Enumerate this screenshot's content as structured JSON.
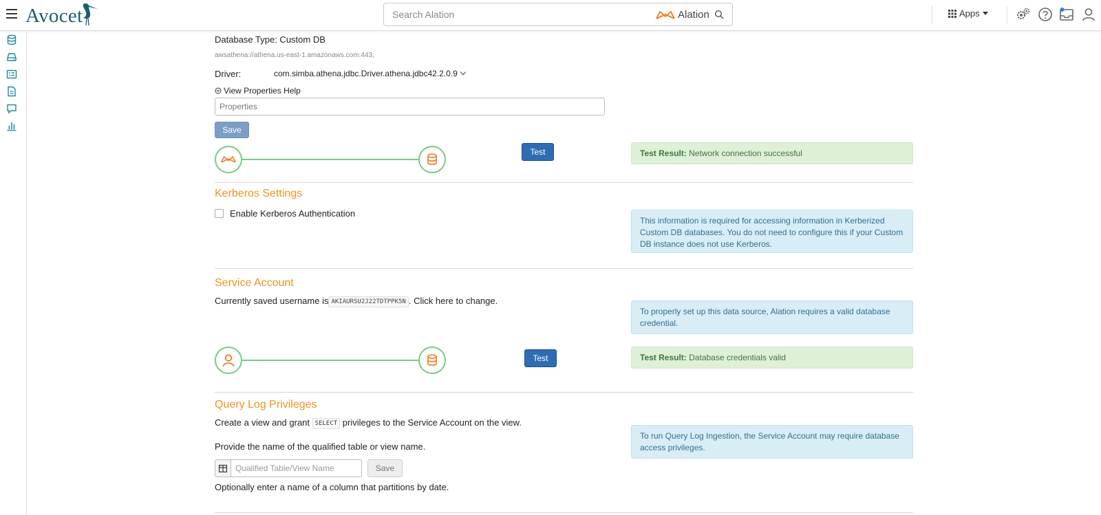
{
  "header": {
    "logo_text": "Avocet",
    "search_placeholder": "Search Alation",
    "search_brand": "Alation",
    "apps_label": "Apps"
  },
  "icons": {
    "menu": "hamburger-icon",
    "search": "search-icon",
    "apps": "grid-icon",
    "settings": "gears-icon",
    "help": "help-icon",
    "inbox": "inbox-icon",
    "user": "user-icon",
    "rail": [
      "database-icon",
      "storage-icon",
      "catalog-icon",
      "document-icon",
      "conversation-icon",
      "bar-chart-icon"
    ]
  },
  "colors": {
    "brand": "#1c5e73",
    "section_title": "#f0931f",
    "success_bg": "#dff0d8",
    "info_bg": "#d9edf7",
    "primary_button": "#2e6db3",
    "connector": "#7ac982",
    "node_icon": "#f07a22"
  },
  "connection": {
    "database_type": "Database Type: Custom DB",
    "jdbc_uri": "awsathena://athena.us-east-1.amazonaws.com:443;",
    "driver_label": "Driver:",
    "driver_value": "com.simba.athena.jdbc.Driver.athena.jdbc42.2.0.9",
    "view_properties_help": "View Properties Help",
    "properties_placeholder": "Properties",
    "save_label": "Save",
    "test_label": "Test",
    "test_result_label": "Test Result:",
    "test_result_text": "Network connection successful"
  },
  "kerberos": {
    "title": "Kerberos Settings",
    "checkbox_label": "Enable Kerberos Authentication",
    "checked": false,
    "info": "This information is required for accessing information in Kerberized Custom DB databases. You do not need to configure this if your Custom DB instance does not use Kerberos."
  },
  "service_account": {
    "title": "Service Account",
    "text_before": "Currently saved username is",
    "username": "AKIAURSU2J22TDTPPK5N",
    "text_middle": ". Click",
    "link_text": "here",
    "text_after": "to change.",
    "info": "To properly set up this data source, Alation requires a valid database credential.",
    "test_label": "Test",
    "test_result_label": "Test Result:",
    "test_result_text": "Database credentials valid"
  },
  "query_log": {
    "title": "Query Log Privileges",
    "text1_before": "Create a view and grant",
    "privilege": "SELECT",
    "text1_after": "privileges to the Service Account on the view.",
    "text2": "Provide the name of the qualified table or view name.",
    "input_placeholder": "Qualified Table/View Name",
    "save_label": "Save",
    "text3": "Optionally enter a name of a column that partitions by date.",
    "info": "To run Query Log Ingestion, the Service Account may require database access privileges."
  }
}
